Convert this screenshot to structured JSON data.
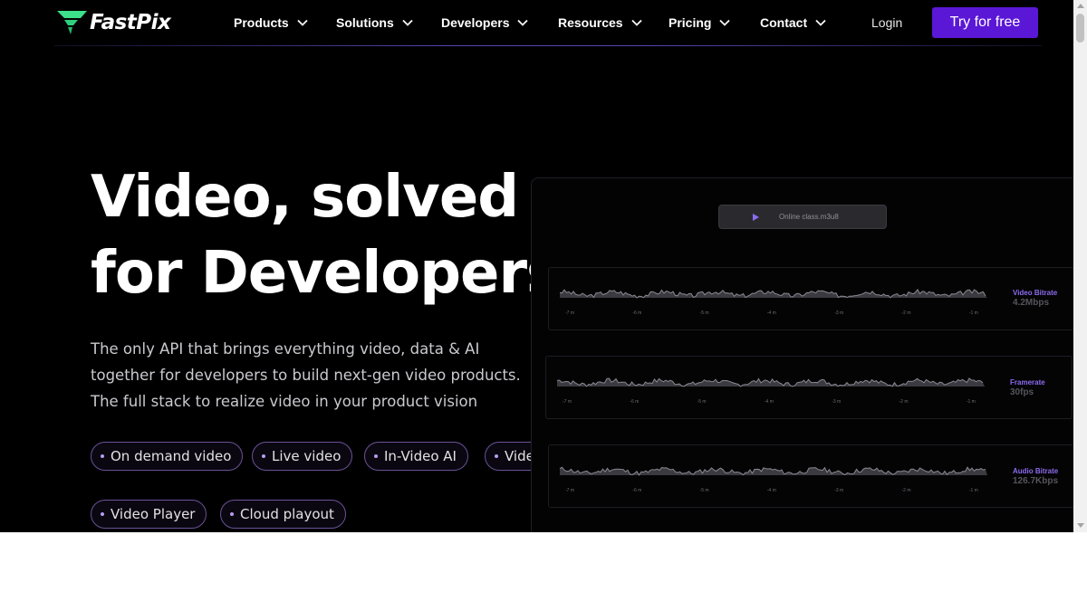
{
  "brand": {
    "name": "FastPix",
    "accent": "#5b17d6",
    "logo_color": "#3de08a"
  },
  "nav": {
    "items": [
      {
        "label": "Products"
      },
      {
        "label": "Solutions"
      },
      {
        "label": "Developers"
      },
      {
        "label": "Resources"
      },
      {
        "label": "Pricing"
      },
      {
        "label": "Contact"
      }
    ],
    "login_label": "Login",
    "cta_label": "Try for free"
  },
  "hero": {
    "title_line1": "Video, solved",
    "title_line2": "for Developers",
    "subtitle_lines": [
      "The only API that brings everything video, data & AI",
      "together for developers to build next-gen video products.",
      "The full stack to realize video in your product vision"
    ],
    "chips": [
      "On demand video",
      "Live video",
      "In-Video AI",
      "Video",
      "Video Player",
      "Cloud playout"
    ]
  },
  "dashboard": {
    "file_name": "Online class.m3u8",
    "play_icon": "play-icon",
    "tick_labels": [
      "-7 m",
      "-6 m",
      "-5 m",
      "-4 m",
      "-3 m",
      "-2 m",
      "-1 m"
    ],
    "metrics": [
      {
        "label": "Video Bitrate",
        "value": "4.2Mbps"
      },
      {
        "label": "Framerate",
        "value": "30fps"
      },
      {
        "label": "Audio Bitrate",
        "value": "126.7Kbps"
      }
    ]
  }
}
